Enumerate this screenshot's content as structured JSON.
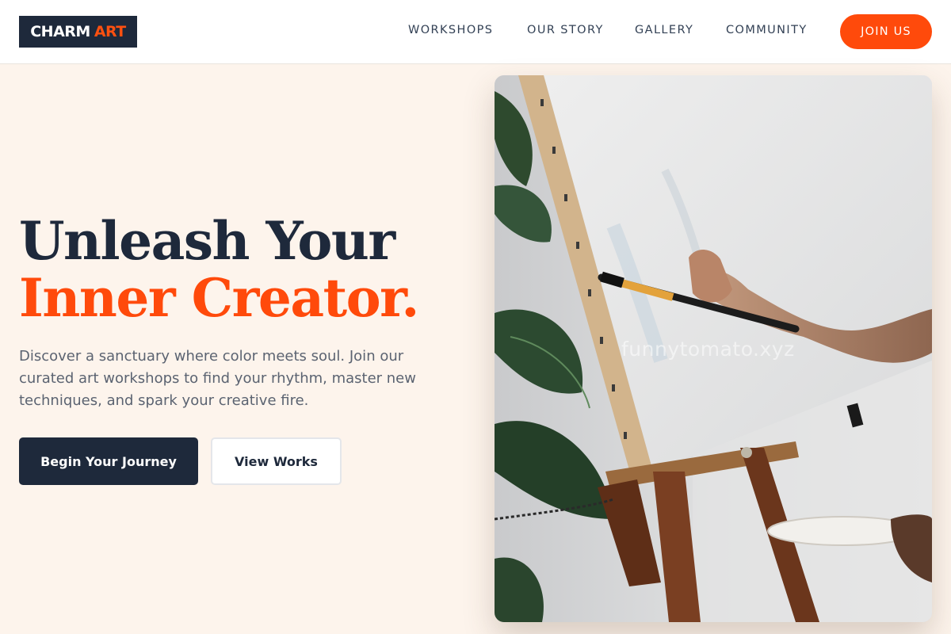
{
  "brand": {
    "logo_main": "CHARM",
    "logo_accent": "ART",
    "accent_color": "#FF4A0B",
    "dark_color": "#1E293B",
    "background_color": "#FDF4EC"
  },
  "nav": {
    "items": [
      {
        "label": "WORKSHOPS"
      },
      {
        "label": "OUR STORY"
      },
      {
        "label": "GALLERY"
      },
      {
        "label": "COMMUNITY"
      }
    ],
    "cta_label": "JOIN US"
  },
  "hero": {
    "headline_line1": "Unleash Your",
    "headline_line2": "Inner Creator.",
    "description": "Discover a sanctuary where color meets soul. Join our curated art workshops to find your rhythm, master new techniques, and spark your creative fire.",
    "primary_button": "Begin Your Journey",
    "secondary_button": "View Works",
    "image": {
      "watermark": "funnytomato.xyz"
    }
  }
}
